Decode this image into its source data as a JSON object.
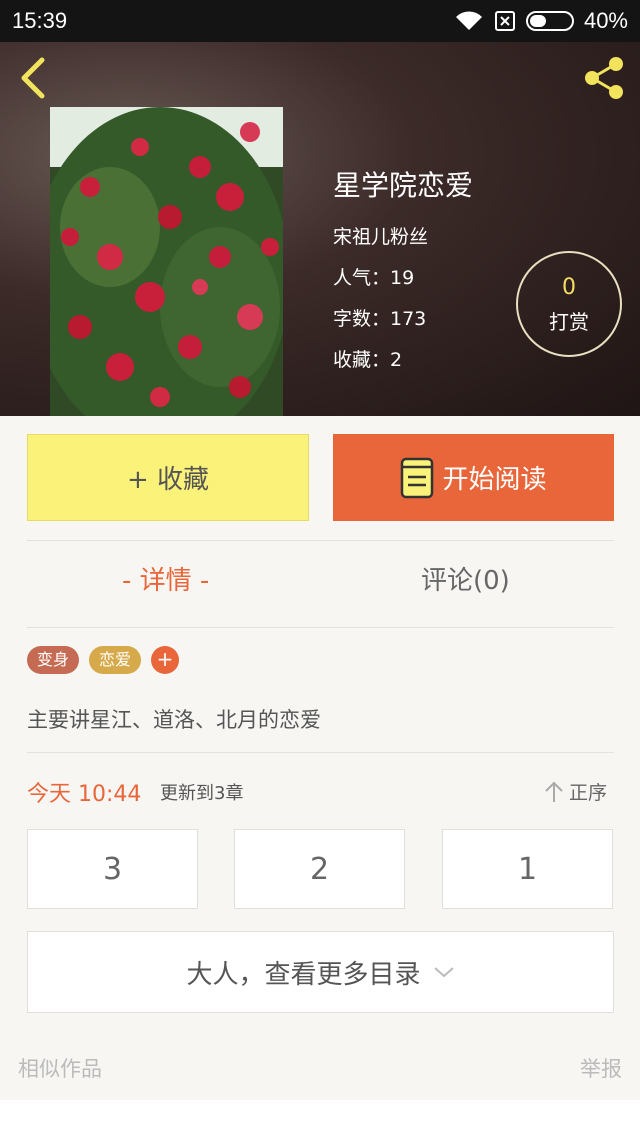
{
  "status_bar": {
    "time": "15:39",
    "battery": "40%",
    "battery_level": 0.4
  },
  "book": {
    "title": "星学院恋爱",
    "author": "宋祖儿粉丝",
    "popularity": "人气：19",
    "word_count": "字数：173",
    "favorites": "收藏：2",
    "reward_count": "0",
    "reward_label": "打赏"
  },
  "actions": {
    "collect_label": "+ 收藏",
    "read_label": "开始阅读"
  },
  "tabs": {
    "detail": "- 详情 -",
    "comment": "评论(0)"
  },
  "tags": [
    "变身",
    "恋爱"
  ],
  "tag_add": "+",
  "description": "主要讲星江、道洛、北月的恋爱",
  "update": {
    "time": "今天 10:44",
    "text": "更新到3章",
    "order": "正序"
  },
  "chapters": [
    "3",
    "2",
    "1"
  ],
  "more_catalog": "大人，查看更多目录",
  "footer": {
    "similar": "相似作品",
    "report": "举报"
  },
  "colors": {
    "accent": "#e8663a",
    "collect_bg": "#fbf27a",
    "reward_gold": "#f5dd61",
    "icon_yellow": "#f2e35c"
  },
  "icons": [
    "back-icon",
    "share-icon",
    "book-icon",
    "chevron-down-icon",
    "arrow-up-icon",
    "wifi-icon",
    "sim-icon",
    "battery-icon"
  ]
}
